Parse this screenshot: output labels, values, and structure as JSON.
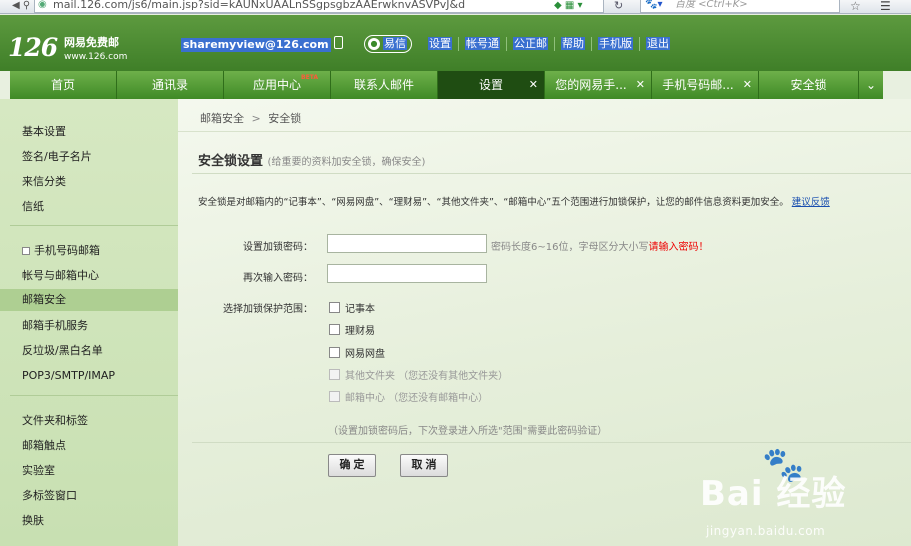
{
  "browser": {
    "url": "mail.126.com/js6/main.jsp?sid=kAUNxUAALnSSgpsgbzAAErwknvASVPvJ&d",
    "search_placeholder": "百度 <Ctrl+K>"
  },
  "header": {
    "logo_number": "126",
    "logo_name": "网易免费邮",
    "logo_url": "www.126.com",
    "user_email": "sharemyview@126.com",
    "yixin_label": "易信",
    "top_links": [
      "设置",
      "帐号通",
      "公正邮",
      "帮助",
      "手机版",
      "退出"
    ]
  },
  "tabs": [
    {
      "label": "首页",
      "active": false,
      "closable": false
    },
    {
      "label": "通讯录",
      "active": false,
      "closable": false
    },
    {
      "label": "应用中心",
      "active": false,
      "closable": false,
      "badge": "BETA"
    },
    {
      "label": "联系人邮件",
      "active": false,
      "closable": false
    },
    {
      "label": "设置",
      "active": true,
      "closable": true
    },
    {
      "label": "您的网易手...",
      "active": false,
      "closable": true
    },
    {
      "label": "手机号码邮...",
      "active": false,
      "closable": true
    },
    {
      "label": "安全锁",
      "active": false,
      "closable": false
    }
  ],
  "sidebar": {
    "group1": [
      "基本设置",
      "签名/电子名片",
      "来信分类",
      "信纸"
    ],
    "group2": [
      "手机号码邮箱",
      "帐号与邮箱中心",
      "邮箱安全",
      "邮箱手机服务",
      "反垃圾/黑白名单",
      "POP3/SMTP/IMAP"
    ],
    "group3": [
      "文件夹和标签",
      "邮箱触点",
      "实验室",
      "多标签窗口",
      "换肤"
    ],
    "active_item": "邮箱安全"
  },
  "main": {
    "breadcrumb": [
      "邮箱安全",
      "安全锁"
    ],
    "breadcrumb_sep": ">",
    "title": "安全锁设置",
    "title_hint": "(给重要的资料加安全锁，确保安全)",
    "description": "安全锁是对邮箱内的“记事本”、“网易网盘”、“理财易”、“其他文件夹”、“邮箱中心”五个范围进行加锁保护，让您的邮件信息资料更加安全。",
    "feedback_link": "建议反馈",
    "form": {
      "password_label": "设置加锁密码：",
      "password_value": "",
      "password_hint": "密码长度6~16位，字母区分大小写",
      "password_error": "请输入密码！",
      "confirm_label": "再次输入密码：",
      "confirm_value": "",
      "scope_label": "选择加锁保护范围：",
      "scopes": [
        {
          "label": "记事本",
          "checked": false,
          "disabled": false
        },
        {
          "label": "理财易",
          "checked": false,
          "disabled": false
        },
        {
          "label": "网易网盘",
          "checked": false,
          "disabled": false
        },
        {
          "label": "其他文件夹 （您还没有其他文件夹）",
          "checked": false,
          "disabled": true
        },
        {
          "label": "邮箱中心 （您还没有邮箱中心）",
          "checked": false,
          "disabled": true
        }
      ],
      "note": "（设置加锁密码后，下次登录进入所选\"范围\"需要此密码验证）",
      "ok_label": "确 定",
      "cancel_label": "取 消"
    }
  },
  "watermark": {
    "brand": "Bai 经验",
    "url": "jingyan.baidu.com"
  }
}
